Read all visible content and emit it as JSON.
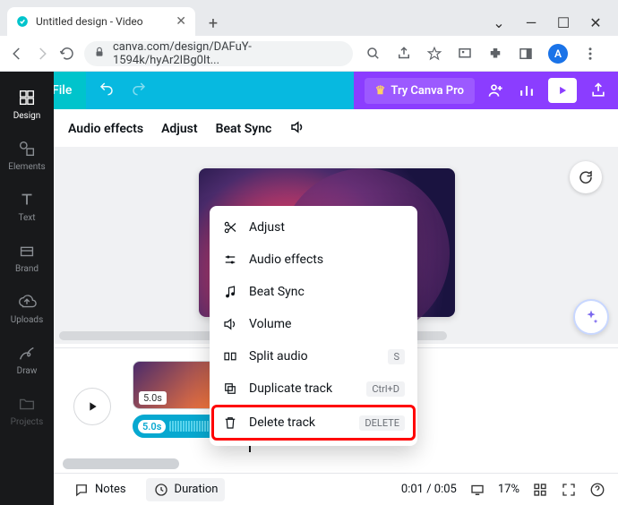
{
  "window": {
    "tab_title": "Untitled design - Video",
    "url_display": "canva.com/design/DAFuY-1594k/hyAr2IBg0It...",
    "avatar_letter": "A"
  },
  "canva_bar": {
    "file_label": "File",
    "try_pro_label": "Try Canva Pro"
  },
  "sec_bar": {
    "audio_effects": "Audio effects",
    "adjust": "Adjust",
    "beat_sync": "Beat Sync"
  },
  "left_rail": [
    {
      "label": "Design",
      "icon": "grid"
    },
    {
      "label": "Elements",
      "icon": "shapes"
    },
    {
      "label": "Text",
      "icon": "text"
    },
    {
      "label": "Brand",
      "icon": "brand"
    },
    {
      "label": "Uploads",
      "icon": "cloud"
    },
    {
      "label": "Draw",
      "icon": "pen"
    },
    {
      "label": "Projects",
      "icon": "folder"
    }
  ],
  "context_menu": {
    "items": [
      {
        "label": "Adjust",
        "icon": "crop",
        "shortcut": ""
      },
      {
        "label": "Audio effects",
        "icon": "sliders",
        "shortcut": ""
      },
      {
        "label": "Beat Sync",
        "icon": "music-note",
        "shortcut": ""
      },
      {
        "label": "Volume",
        "icon": "speaker",
        "shortcut": ""
      },
      {
        "label": "Split audio",
        "icon": "split",
        "shortcut": "S"
      },
      {
        "label": "Duplicate track",
        "icon": "duplicate",
        "shortcut": "Ctrl+D"
      },
      {
        "label": "Delete track",
        "icon": "trash",
        "shortcut": "DELETE",
        "highlight": true
      }
    ]
  },
  "timeline": {
    "video_clip_duration": "5.0s",
    "audio_clip_duration": "5.0s"
  },
  "footer": {
    "notes_label": "Notes",
    "duration_label": "Duration",
    "time_display": "0:01 / 0:05",
    "zoom_display": "17%"
  }
}
